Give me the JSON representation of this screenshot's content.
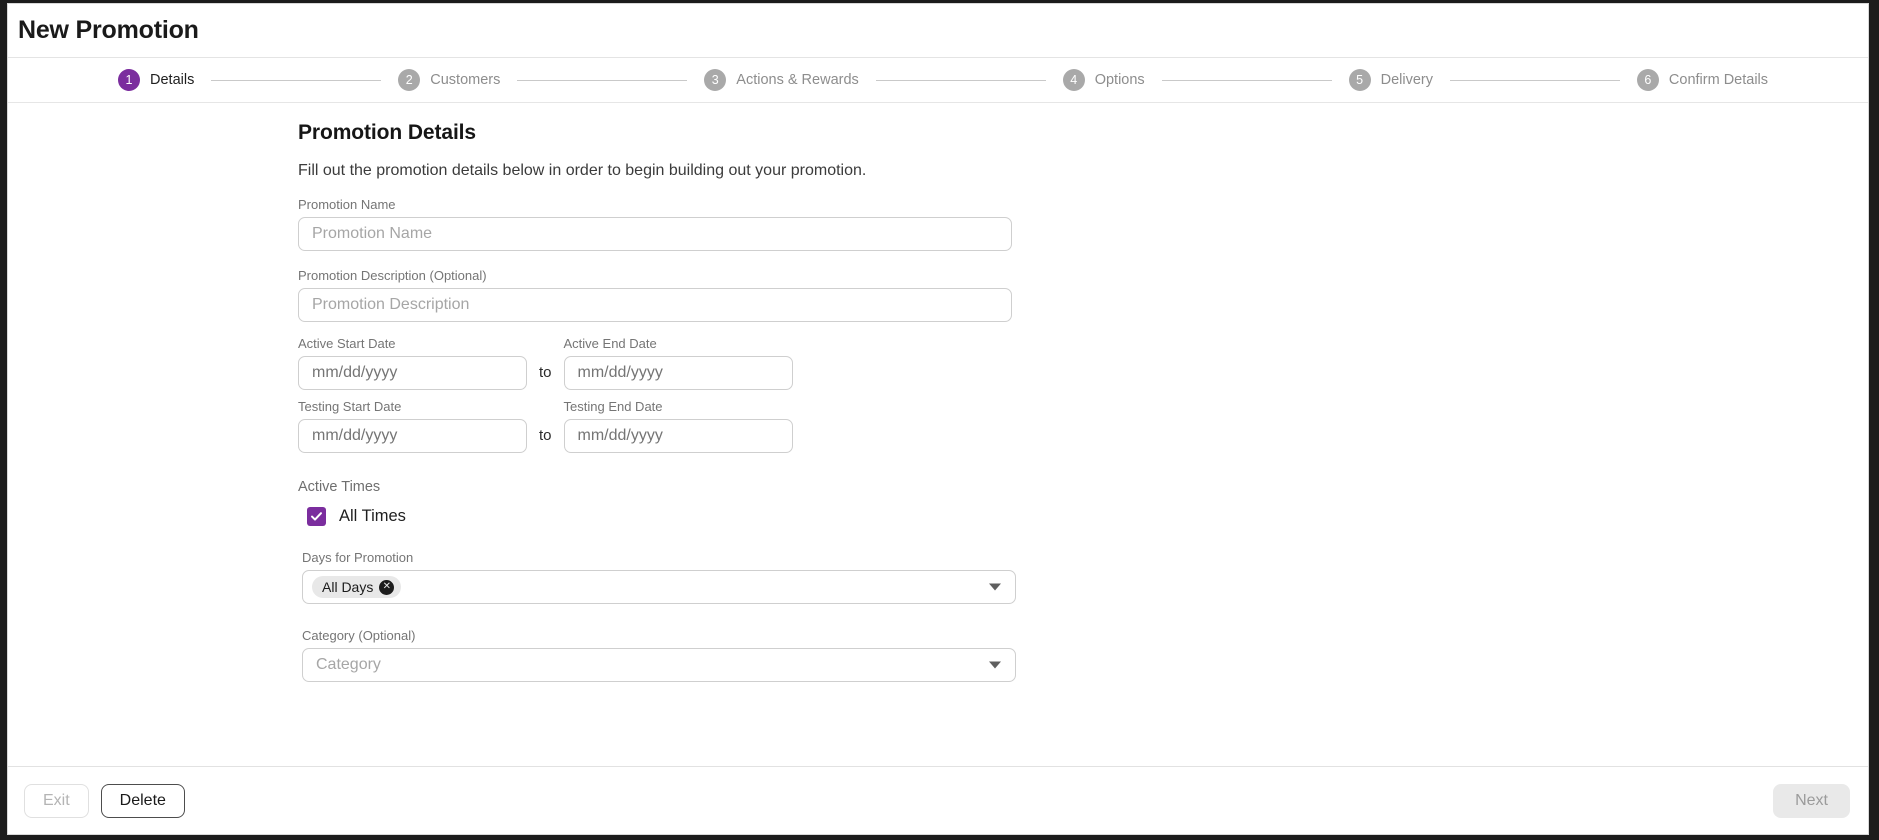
{
  "window": {
    "title": "New Promotion"
  },
  "stepper": {
    "steps": [
      {
        "number": "1",
        "label": "Details",
        "state": "active"
      },
      {
        "number": "2",
        "label": "Customers",
        "state": "inactive"
      },
      {
        "number": "3",
        "label": "Actions & Rewards",
        "state": "inactive"
      },
      {
        "number": "4",
        "label": "Options",
        "state": "inactive"
      },
      {
        "number": "5",
        "label": "Delivery",
        "state": "inactive"
      },
      {
        "number": "6",
        "label": "Confirm Details",
        "state": "inactive"
      }
    ]
  },
  "form": {
    "heading": "Promotion Details",
    "description": "Fill out the promotion details below in order to begin building out your promotion.",
    "promotion_name": {
      "label": "Promotion Name",
      "value": "",
      "placeholder": "Promotion Name"
    },
    "promotion_description": {
      "label": "Promotion Description (Optional)",
      "value": "",
      "placeholder": "Promotion Description"
    },
    "active_start_date": {
      "label": "Active Start Date",
      "value": "",
      "placeholder": "mm/dd/yyyy"
    },
    "active_end_date": {
      "label": "Active End Date",
      "value": "",
      "placeholder": "mm/dd/yyyy"
    },
    "testing_start_date": {
      "label": "Testing Start Date",
      "value": "",
      "placeholder": "mm/dd/yyyy"
    },
    "testing_end_date": {
      "label": "Testing End Date",
      "value": "",
      "placeholder": "mm/dd/yyyy"
    },
    "date_separator": "to",
    "active_times": {
      "label": "Active Times",
      "checkbox_label": "All Times",
      "checked": true
    },
    "days_for_promotion": {
      "label": "Days for Promotion",
      "chips": [
        "All Days"
      ],
      "chip_remove_glyph": "✕"
    },
    "category": {
      "label": "Category (Optional)",
      "value": "",
      "placeholder": "Category"
    }
  },
  "footer": {
    "exit_label": "Exit",
    "delete_label": "Delete",
    "next_label": "Next"
  },
  "colors": {
    "accent_purple": "#7b2d9e",
    "step_inactive": "#a9a9a9",
    "border": "#cfcfcf"
  }
}
